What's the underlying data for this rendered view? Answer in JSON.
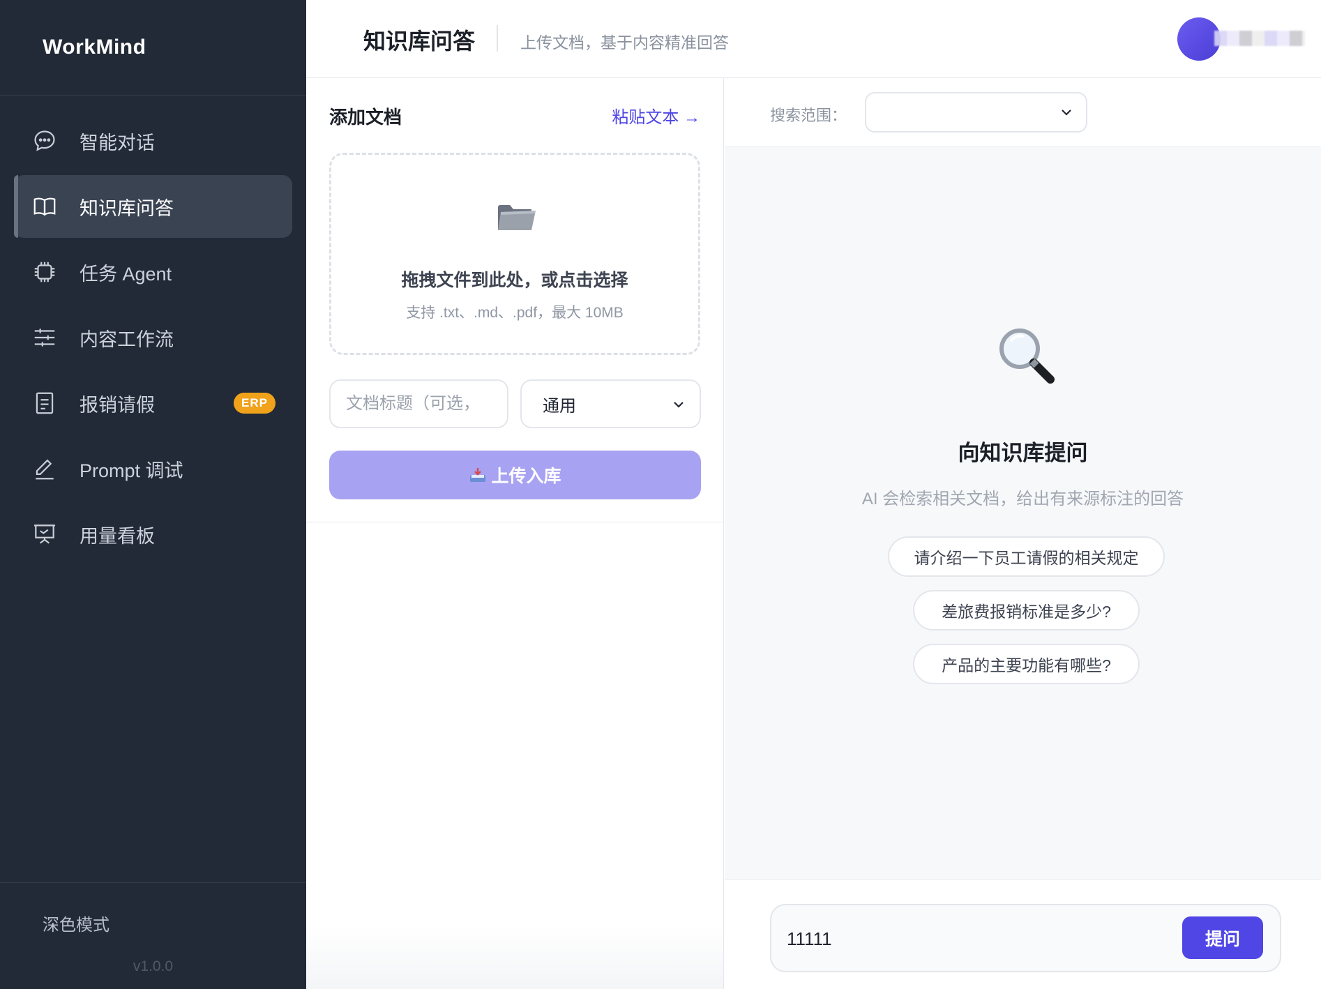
{
  "app": {
    "brand": "WorkMind"
  },
  "sidebar": {
    "items": [
      {
        "label": "智能对话",
        "icon": "chat-bubble-icon"
      },
      {
        "label": "知识库问答",
        "icon": "book-icon",
        "active": true
      },
      {
        "label": "任务 Agent",
        "icon": "chip-icon"
      },
      {
        "label": "内容工作流",
        "icon": "sliders-icon"
      },
      {
        "label": "报销请假",
        "icon": "document-icon",
        "badge": "ERP"
      },
      {
        "label": "Prompt 调试",
        "icon": "pen-icon"
      },
      {
        "label": "用量看板",
        "icon": "presentation-board-icon"
      }
    ],
    "dark_mode_label": "深色模式",
    "version": "v1.0.0"
  },
  "header": {
    "title": "知识库问答",
    "subtitle": "上传文档，基于内容精准回答"
  },
  "upload_panel": {
    "title": "添加文档",
    "paste_link": "粘贴文本 →",
    "dropzone_text": "拖拽文件到此处，或点击选择",
    "dropzone_hint": "支持 .txt、.md、.pdf，最大 10MB",
    "doc_title_placeholder": "文档标题（可选，",
    "category_value": "通用",
    "upload_button": "上传入库"
  },
  "qa_panel": {
    "scope_label": "搜索范围：",
    "scope_value": "",
    "empty_title": "向知识库提问",
    "empty_desc": "AI 会检索相关文档，给出有来源标注的回答",
    "suggestions": [
      "请介绍一下员工请假的相关规定",
      "差旅费报销标准是多少?",
      "产品的主要功能有哪些?"
    ],
    "question_value": "11111",
    "ask_button": "提问"
  },
  "colors": {
    "sidebar_bg": "#222a37",
    "accent": "#4f46e5",
    "upload_disabled": "#a8a2f2",
    "badge": "#f0a21b"
  }
}
